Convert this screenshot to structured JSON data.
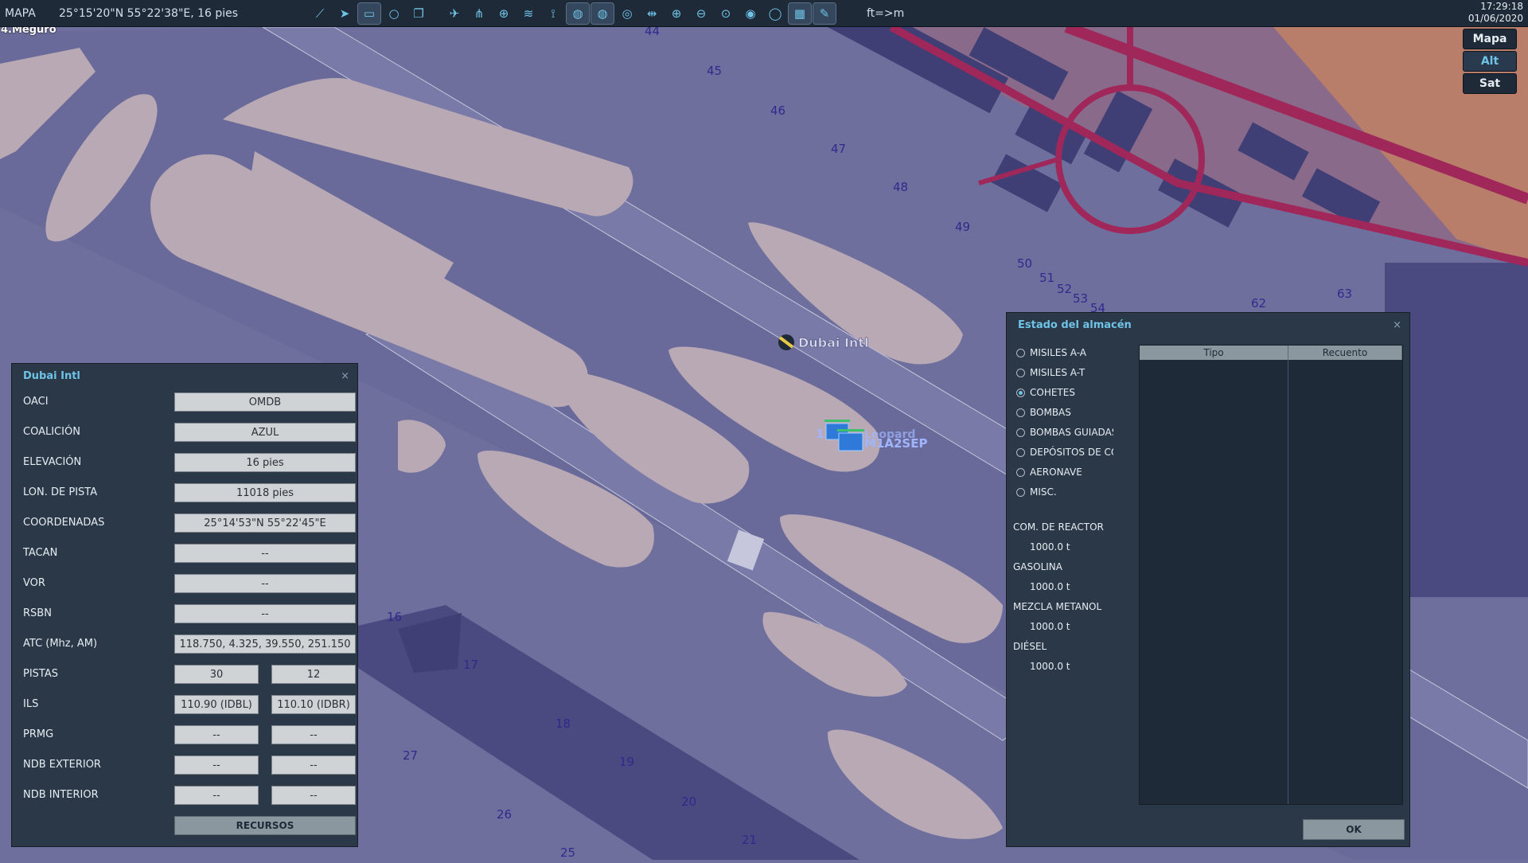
{
  "topbar": {
    "mode": "MAPA",
    "coordinates": "25°15'20\"N 55°22'38\"E, 16 pies",
    "units": "ft=>m",
    "time": "17:29:18",
    "date": "01/06/2020"
  },
  "toolbar_icons": [
    "route-icon",
    "waypoint-icon",
    "ruler-icon",
    "circle-icon",
    "layers-icon",
    "aircraft-icon",
    "network-icon",
    "target-icon",
    "wifi-icon",
    "tower-icon",
    "search-area-icon",
    "search-area-2-icon",
    "search-area-3-icon",
    "pan-icon",
    "zoom-in-icon",
    "zoom-out-icon",
    "zoom-reset-icon",
    "radar-icon",
    "globe-icon",
    "grid-icon",
    "pencil-icon"
  ],
  "map": {
    "scale_label": "4.Meguro",
    "airport_label": "Dubai Intl",
    "unit_label_1": "1",
    "unit_label_2": "M1A2SEP",
    "unit_label_3": "Leopard",
    "numbers": [
      "44",
      "45",
      "46",
      "47",
      "48",
      "49",
      "50",
      "51",
      "52",
      "53",
      "54",
      "62",
      "63",
      "16",
      "17",
      "18",
      "19",
      "20",
      "21",
      "25",
      "26",
      "27"
    ],
    "modes": [
      "Mapa",
      "Alt",
      "Sat"
    ],
    "active_mode": "Alt",
    "colors": {
      "ground": "#6f6f9e",
      "runway": "#b8a9b4",
      "roads": "#a0275a",
      "buildings": "#3f3f76",
      "urban": "#b97e6a"
    }
  },
  "airport_panel": {
    "title": "Dubai Intl",
    "close": "×",
    "fields": [
      {
        "label": "OACI",
        "value": "OMDB"
      },
      {
        "label": "COALICIÓN",
        "value": "AZUL"
      },
      {
        "label": "ELEVACIÓN",
        "value": "16 pies"
      },
      {
        "label": "LON. DE PISTA",
        "value": "11018 pies"
      },
      {
        "label": "COORDENADAS",
        "value": "25°14'53\"N 55°22'45\"E"
      },
      {
        "label": "TACAN",
        "value": "--"
      },
      {
        "label": "VOR",
        "value": "--"
      },
      {
        "label": "RSBN",
        "value": "--"
      },
      {
        "label": "ATC  (Mhz, AM)",
        "value": "118.750, 4.325, 39.550, 251.150"
      }
    ],
    "pair_fields": [
      {
        "label": "PISTAS",
        "values": [
          "30",
          "12"
        ]
      },
      {
        "label": "ILS",
        "values": [
          "110.90 (IDBL)",
          "110.10 (IDBR)"
        ]
      },
      {
        "label": "PRMG",
        "values": [
          "--",
          "--"
        ]
      },
      {
        "label": "NDB EXTERIOR",
        "values": [
          "--",
          "--"
        ]
      },
      {
        "label": "NDB INTERIOR",
        "values": [
          "--",
          "--"
        ]
      }
    ],
    "resources_button": "RECURSOS"
  },
  "warehouse_panel": {
    "title": "Estado del almacén",
    "close": "×",
    "categories": [
      "MISILES A-A",
      "MISILES A-T",
      "COHETES",
      "BOMBAS",
      "BOMBAS GUIADAS",
      "DEPÓSITOS DE COMBUSTIBLE",
      "AERONAVE",
      "MISC."
    ],
    "selected_category": "COHETES",
    "fuels": [
      {
        "name": "COM. DE REACTOR",
        "value": "1000.0 t"
      },
      {
        "name": "GASOLINA",
        "value": "1000.0 t"
      },
      {
        "name": "MEZCLA METANOL",
        "value": "1000.0 t"
      },
      {
        "name": "DIÉSEL",
        "value": "1000.0 t"
      }
    ],
    "table_headers": [
      "Tipo",
      "Recuento"
    ],
    "ok_button": "OK"
  }
}
